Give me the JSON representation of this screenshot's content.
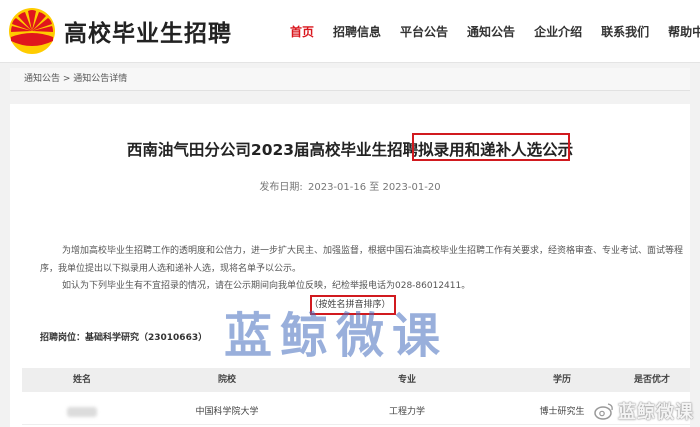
{
  "header": {
    "site_title": "高校毕业生招聘",
    "nav": [
      {
        "label": "首页",
        "active": true
      },
      {
        "label": "招聘信息",
        "active": false
      },
      {
        "label": "平台公告",
        "active": false
      },
      {
        "label": "通知公告",
        "active": false
      },
      {
        "label": "企业介绍",
        "active": false
      },
      {
        "label": "联系我们",
        "active": false
      },
      {
        "label": "帮助中心",
        "active": false
      }
    ],
    "accent_color": "#d9161d"
  },
  "breadcrumb": {
    "root": "通知公告",
    "separator": " > ",
    "current": "通知公告详情"
  },
  "article": {
    "title": "西南油气田分公司2023届高校毕业生招聘拟录用和递补人选公示",
    "date_label": "发布日期:",
    "date_range": "2023-01-16 至 2023-01-20",
    "paragraph1_line1": "为增加高校毕业生招聘工作的透明度和公信力，进一步扩大民主、加强监督，根据中国石油高校毕业生招聘工作有关要求，经资格审查、专业考试、面试等程",
    "paragraph1_line2": "序，我单位提出以下拟录用人选和递补人选，现将名单予以公示。",
    "paragraph2": "如认为下列毕业生有不宜招录的情况，请在公示期间向我单位反映，纪检举报电话为028-86012411。",
    "sort_note": "（按姓名拼音排序）",
    "position_label": "招聘岗位：基础科学研究（23010663）"
  },
  "table": {
    "headers": [
      "姓名",
      "院校",
      "专业",
      "学历",
      "是否优才"
    ],
    "rows": [
      {
        "name": "",
        "school": "中国科学院大学",
        "major": "工程力学",
        "degree": "博士研究生",
        "talent": ""
      }
    ]
  },
  "watermark": {
    "text": "蓝鲸微课",
    "corner_text": "蓝鲸微课"
  },
  "icons": {
    "logo": "petrochina-sun-logo",
    "corner": "weibo-icon"
  }
}
